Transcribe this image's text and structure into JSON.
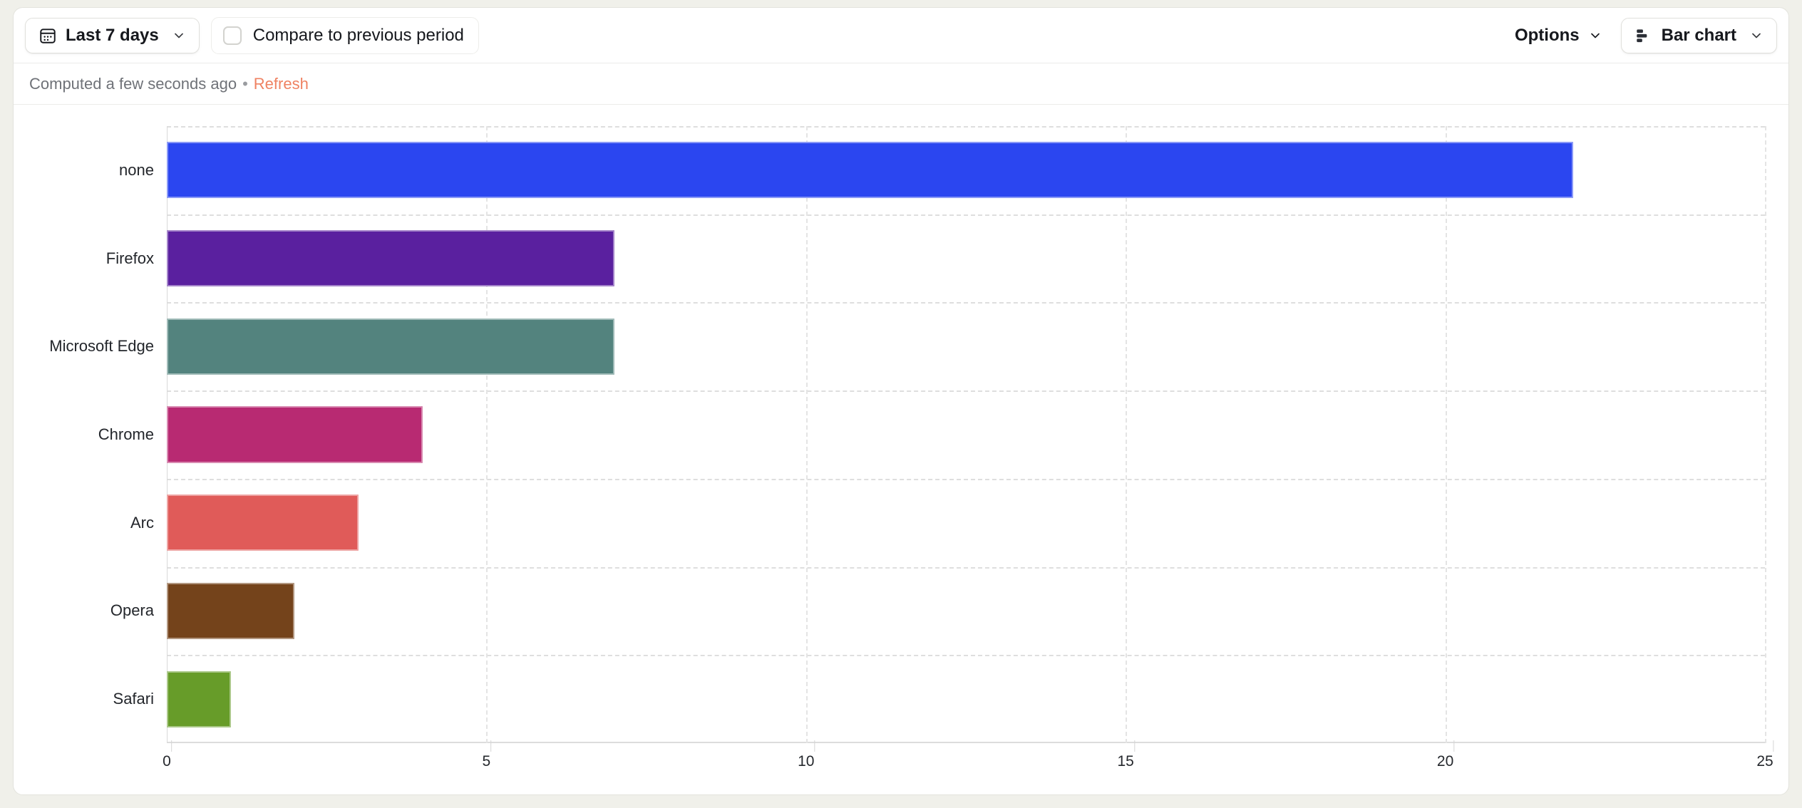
{
  "toolbar": {
    "date_range": {
      "label": "Last 7 days",
      "icon": "calendar-icon",
      "chevron": "chevron-down-icon"
    },
    "compare": {
      "label": "Compare to previous period",
      "checked": false
    },
    "options": {
      "label": "Options",
      "chevron": "chevron-down-icon"
    },
    "chart_type": {
      "label": "Bar chart",
      "icon": "bar-chart-icon",
      "chevron": "chevron-down-icon"
    }
  },
  "status": {
    "computed_text": "Computed a few seconds ago",
    "separator": "•",
    "refresh_label": "Refresh",
    "refresh_color": "#ef8262"
  },
  "chart_data": {
    "type": "bar",
    "orientation": "horizontal",
    "title": "",
    "xlabel": "",
    "ylabel": "",
    "xlim": [
      0,
      25
    ],
    "xticks": [
      0,
      5,
      10,
      15,
      20,
      25
    ],
    "xtick_labels": [
      "0",
      "5",
      "10",
      "15",
      "20",
      "25"
    ],
    "grid": true,
    "legend": "none",
    "categories": [
      "none",
      "Firefox",
      "Microsoft Edge",
      "Chrome",
      "Arc",
      "Opera",
      "Safari"
    ],
    "values": [
      22,
      7,
      7,
      4,
      3,
      2,
      1
    ],
    "colors": [
      "#2b46f0",
      "#5a209f",
      "#53837e",
      "#b82a72",
      "#e05b59",
      "#74431b",
      "#679c29"
    ]
  }
}
